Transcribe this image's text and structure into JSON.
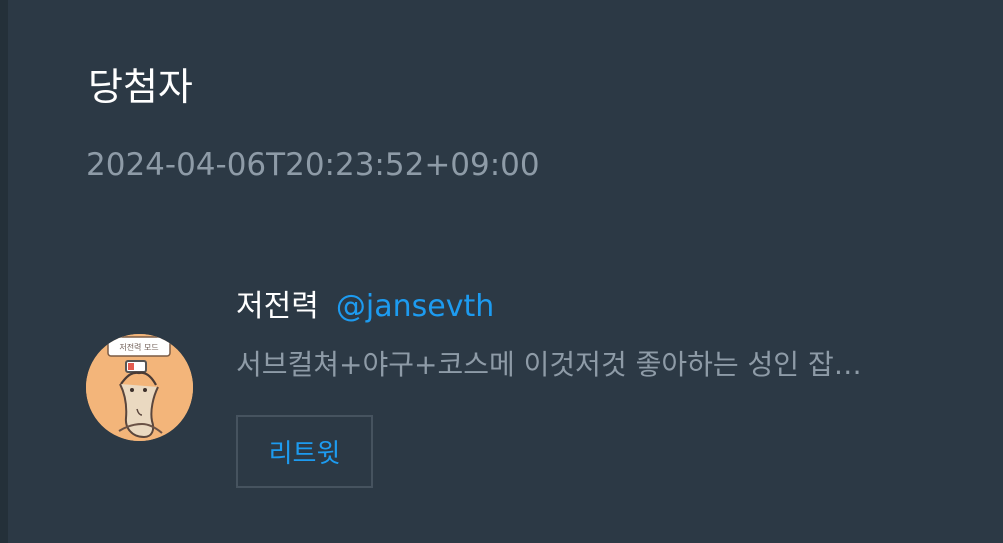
{
  "header": {
    "title": "당첨자",
    "timestamp": "2024-04-06T20:23:52+09:00"
  },
  "winner": {
    "display_name": "저전력",
    "handle": "@jansevth",
    "bio": "서브컬쳐+야구+코스메 이것저것 좋아하는 성인 잡…",
    "avatar_icon": "avatar-icon",
    "avatar_text": "저전력 모드"
  },
  "actions": {
    "retweet_label": "리트윗"
  },
  "colors": {
    "background": "#2c3945",
    "title": "#ffffff",
    "muted": "#8e9ba7",
    "accent": "#1d9bf0",
    "border": "#46535f"
  }
}
